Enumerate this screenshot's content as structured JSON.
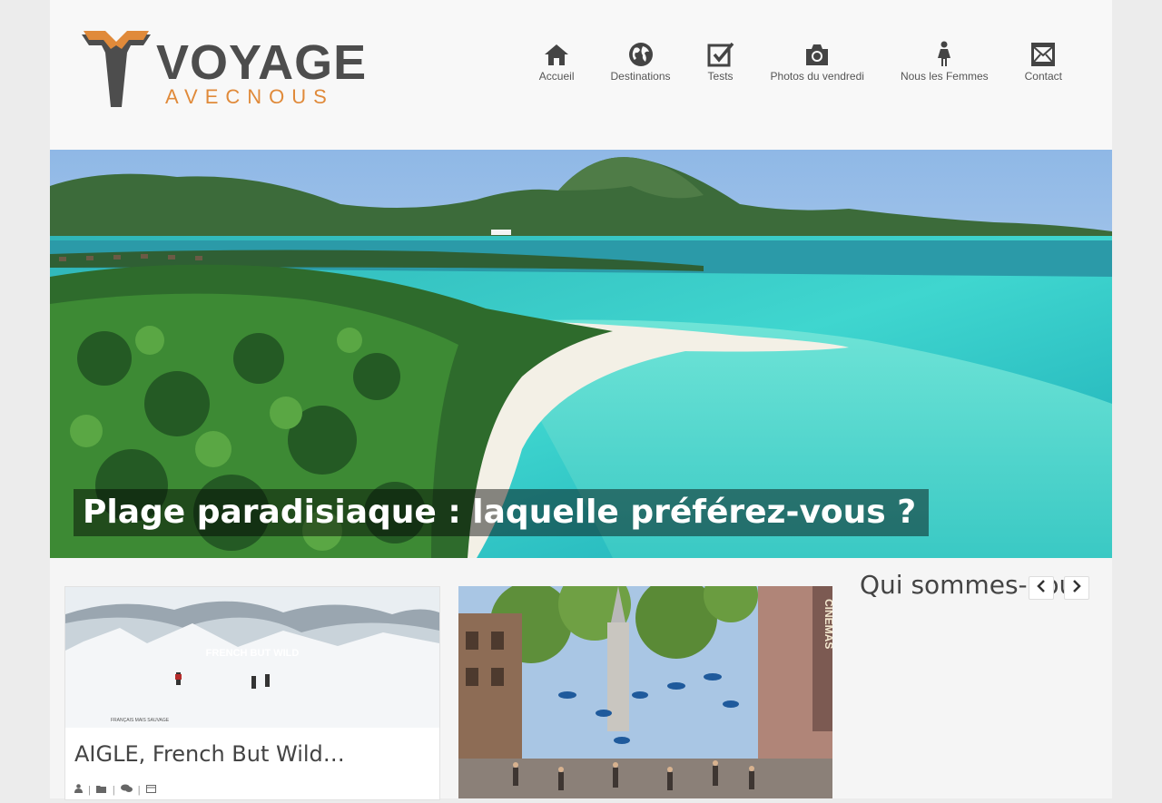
{
  "brand": {
    "main": "VOYAGE",
    "sub": "AVECNOUS",
    "accent_color": "#e08a3a"
  },
  "nav": {
    "items": [
      {
        "label": "Accueil",
        "icon": "home-icon"
      },
      {
        "label": "Destinations",
        "icon": "globe-icon"
      },
      {
        "label": "Tests",
        "icon": "checkbox-icon"
      },
      {
        "label": "Photos du vendredi",
        "icon": "camera-icon"
      },
      {
        "label": "Nous les Femmes",
        "icon": "female-icon"
      },
      {
        "label": "Contact",
        "icon": "mail-icon"
      }
    ]
  },
  "hero": {
    "caption": "Plage paradisiaque : laquelle préférez-vous ?"
  },
  "posts": [
    {
      "title": "AIGLE, French But Wild…",
      "image_text": "FRENCH BUT WILD",
      "image_subtext": "FRANÇAIS MAIS SAUVAGE"
    },
    {
      "title": "",
      "image_text": "CINEMAS"
    }
  ],
  "sidebar": {
    "title": "Qui sommes-nous"
  }
}
